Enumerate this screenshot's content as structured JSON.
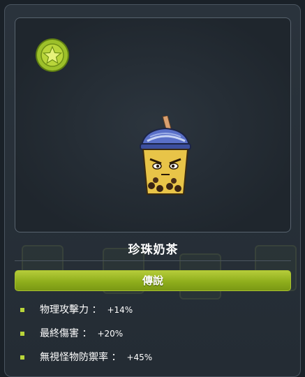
{
  "item": {
    "name": "珍珠奶茶",
    "grade": "傳說",
    "icons": {
      "badge": "star-icon",
      "item_image": "bubble-tea-icon"
    }
  },
  "stats": [
    {
      "name": "物理攻擊力 ：",
      "value": "+14%"
    },
    {
      "name": "最終傷害 ：",
      "value": "+20%"
    },
    {
      "name": "無視怪物防禦率 ：",
      "value": "+45%"
    }
  ],
  "colors": {
    "grade_accent": "#8fae1c",
    "bullet": "#b9d53a",
    "panel_bg": "#242c34"
  }
}
